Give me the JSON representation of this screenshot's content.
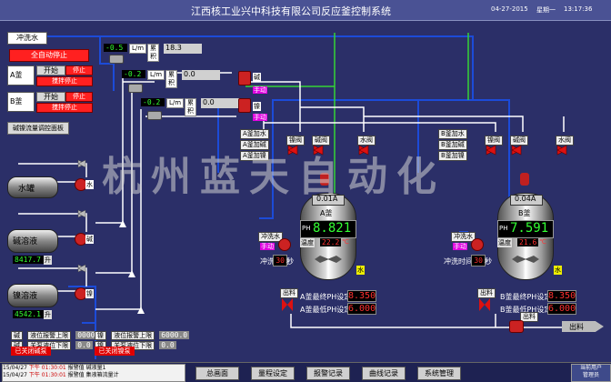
{
  "header": {
    "title": "江西核工业兴中科技有限公司反应釜控制系统",
    "date": "04-27-2015",
    "weekday": "星期一",
    "time": "13:17:36"
  },
  "left_panel": {
    "flush_label": "冲洗水",
    "all_auto_stop": "全自动停止",
    "kettle_a": "A釜",
    "kettle_b": "B釜",
    "start": "开始",
    "stop": "停止",
    "stir_stop": "搅拌停止",
    "acid_base_flow_panel": "碱镍流量调控面板"
  },
  "flow_meters": [
    {
      "value": "-0.5",
      "unit": "L/m",
      "total_label": "累积",
      "total": "18.3"
    },
    {
      "value": "-0.2",
      "unit": "L/m",
      "total_label": "累积",
      "total": "0.0"
    },
    {
      "value": "-0.2",
      "unit": "L/m",
      "total_label": "累积",
      "total": "0.0"
    }
  ],
  "tanks": {
    "water": "水罐",
    "alkali": "碱溶液",
    "nickel": "镍溶液",
    "alkali_level": "8417.7",
    "nickel_level": "4542.1",
    "level_unit": "升",
    "water_tag": "水",
    "alkali_tag": "碱",
    "nickel_tag": "镍"
  },
  "alarm_limits": [
    {
      "tag": "碱",
      "label": "液位报警上限",
      "value": "0000.0"
    },
    {
      "tag": "碱",
      "label": "关泵液位下限",
      "value": "0.0"
    },
    {
      "tag": "镍",
      "label": "液位报警上限",
      "value": "6000.0"
    },
    {
      "tag": "镍",
      "label": "关泵液位下限",
      "value": "0.0"
    }
  ],
  "pump_off_left": "已关闭碱泵",
  "pump_off_right": "已关闭镍泵",
  "valve_tags": {
    "water_valve": "水阀",
    "alkali_valve": "碱阀",
    "nickel_valve": "镍阀",
    "manual": "手动",
    "a_add_water": "A釜加水",
    "a_add_alkali": "A釜加碱",
    "a_add_nickel": "A釜加镍",
    "b_add_water": "B釜加水",
    "b_add_alkali": "B釜加碱",
    "b_add_nickel": "B釜加镍",
    "discharge_valve": "出料",
    "water_tag": "水",
    "alkali_tag": "碱",
    "nickel_tag": "镍"
  },
  "reactor_a": {
    "level": "0.01A",
    "name": "A釜",
    "ph_label": "PH",
    "ph": "8.821",
    "temp_label": "温度",
    "temp": "22.2",
    "temp_unit": "℃",
    "flush_label": "冲洗水",
    "manual": "手动",
    "flush_time_label": "冲洗时间",
    "flush_time": "30",
    "flush_time_unit": "秒",
    "ph_max_label": "A釜最终PH设定",
    "ph_max": "8.350",
    "ph_min_label": "A釜最低PH设定",
    "ph_min": "6.000",
    "discharge_label": "出料"
  },
  "reactor_b": {
    "level": "0.04A",
    "name": "B釜",
    "ph_label": "PH",
    "ph": "7.591",
    "temp_label": "温度",
    "temp": "21.6",
    "temp_unit": "℃",
    "flush_label": "冲洗水",
    "manual": "手动",
    "flush_time_label": "冲洗时间",
    "flush_time": "30",
    "flush_time_unit": "秒",
    "ph_max_label": "B釜最终PH设定",
    "ph_max": "8.350",
    "ph_min_label": "B釜最低PH设定",
    "ph_min": "6.000",
    "discharge_label": "出料"
  },
  "discharge_out": "出料",
  "watermark": "杭州蓝天自动化",
  "alarm_log": [
    {
      "date": "15/04/27",
      "time": "下午 01:30:01",
      "type": "报警值",
      "msg": "碱液量1"
    },
    {
      "date": "15/04/27",
      "time": "下午 01:30:01",
      "type": "报警值",
      "msg": "集液箱流量计"
    }
  ],
  "nav": {
    "main": "总画面",
    "recipe": "量程设定",
    "alarm": "报警记录",
    "trend": "曲线记录",
    "system": "系统管理"
  },
  "user": {
    "label": "当前用户",
    "name": "管理员"
  },
  "colors": {
    "background": "#2b2f68",
    "pipe_white": "#ffffff",
    "pipe_blue": "#1c4bd8",
    "pipe_green": "#35d435",
    "alarm_red": "#ff2020",
    "value_green": "#33ff33"
  }
}
